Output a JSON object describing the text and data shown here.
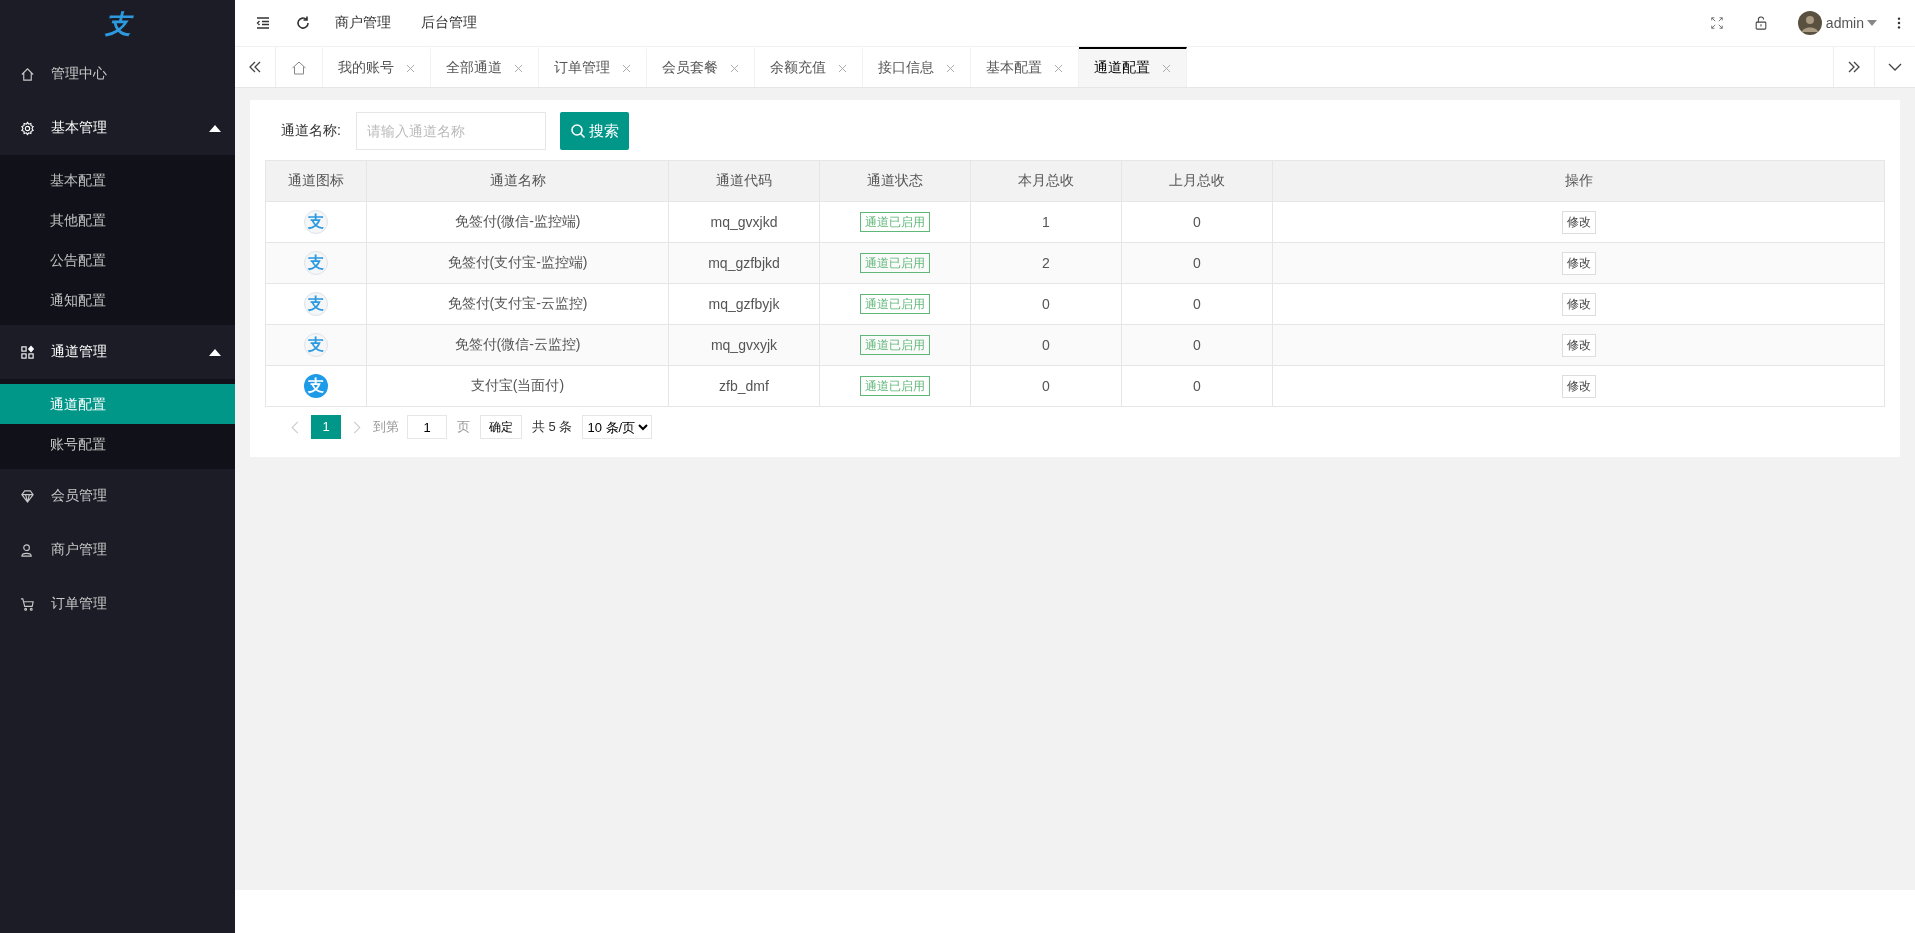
{
  "logo": "支",
  "sidebar": {
    "items": [
      {
        "label": "管理中心",
        "kind": "link",
        "selected": false
      },
      {
        "label": "基本管理",
        "kind": "group",
        "expanded": true,
        "children": [
          {
            "label": "基本配置",
            "selected": false
          },
          {
            "label": "其他配置",
            "selected": false
          },
          {
            "label": "公告配置",
            "selected": false
          },
          {
            "label": "通知配置",
            "selected": false
          }
        ]
      },
      {
        "label": "通道管理",
        "kind": "group",
        "expanded": true,
        "children": [
          {
            "label": "通道配置",
            "selected": true
          },
          {
            "label": "账号配置",
            "selected": false
          }
        ]
      },
      {
        "label": "会员管理",
        "kind": "link",
        "selected": false
      },
      {
        "label": "商户管理",
        "kind": "link",
        "selected": false
      },
      {
        "label": "订单管理",
        "kind": "link",
        "selected": false
      }
    ]
  },
  "header": {
    "links": [
      "商户管理",
      "后台管理"
    ],
    "user": "admin"
  },
  "tabs": [
    {
      "label": "我的账号",
      "selected": false
    },
    {
      "label": "全部通道",
      "selected": false
    },
    {
      "label": "订单管理",
      "selected": false
    },
    {
      "label": "会员套餐",
      "selected": false
    },
    {
      "label": "余额充值",
      "selected": false
    },
    {
      "label": "接口信息",
      "selected": false
    },
    {
      "label": "基本配置",
      "selected": false
    },
    {
      "label": "通道配置",
      "selected": true
    }
  ],
  "search": {
    "label": "通道名称:",
    "placeholder": "请输入通道名称",
    "button": "搜索"
  },
  "table": {
    "columns": [
      "通道图标",
      "通道名称",
      "通道代码",
      "通道状态",
      "本月总收",
      "上月总收",
      "操作"
    ],
    "rows": [
      {
        "icon": {
          "glyph": "支",
          "solid": false
        },
        "name": "免签付(微信-监控端)",
        "code": "mq_gvxjkd",
        "status": {
          "text": "通道已启用",
          "enabled": true
        },
        "this_month": "1",
        "last_month": "0",
        "action": "修改"
      },
      {
        "icon": {
          "glyph": "支",
          "solid": false
        },
        "name": "免签付(支付宝-监控端)",
        "code": "mq_gzfbjkd",
        "status": {
          "text": "通道已启用",
          "enabled": true
        },
        "this_month": "2",
        "last_month": "0",
        "action": "修改"
      },
      {
        "icon": {
          "glyph": "支",
          "solid": false
        },
        "name": "免签付(支付宝-云监控)",
        "code": "mq_gzfbyjk",
        "status": {
          "text": "通道已启用",
          "enabled": true
        },
        "this_month": "0",
        "last_month": "0",
        "action": "修改"
      },
      {
        "icon": {
          "glyph": "支",
          "solid": false
        },
        "name": "免签付(微信-云监控)",
        "code": "mq_gvxyjk",
        "status": {
          "text": "通道已启用",
          "enabled": true
        },
        "this_month": "0",
        "last_month": "0",
        "action": "修改"
      },
      {
        "icon": {
          "glyph": "支",
          "solid": true
        },
        "name": "支付宝(当面付)",
        "code": "zfb_dmf",
        "status": {
          "text": "通道已启用",
          "enabled": true
        },
        "this_month": "0",
        "last_month": "0",
        "action": "修改"
      }
    ]
  },
  "pagination": {
    "pages": [
      {
        "label": "1",
        "selected": true
      }
    ],
    "goto_label": "到第",
    "goto_value": "1",
    "page_unit": "页",
    "confirm": "确定",
    "total": "共 5 条",
    "page_size": "10 条/页"
  }
}
